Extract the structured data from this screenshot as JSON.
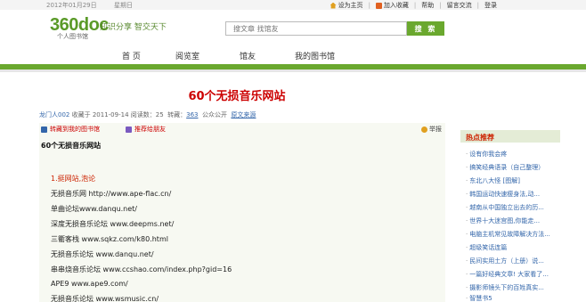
{
  "topbar": {
    "date": "2012年01月29日",
    "weekday": "星期日",
    "links": [
      "设为主页",
      "加入收藏",
      "帮助",
      "留言交流",
      "登录"
    ]
  },
  "header": {
    "logo": "360doc",
    "logo_sub": "个人图书馆",
    "slogan": "知识分享  智交天下",
    "search_placeholder": "搜文章 找馆友",
    "search_button": "搜 索"
  },
  "nav": {
    "items": [
      "首 页",
      "阅览室",
      "馆友",
      "我的图书馆"
    ]
  },
  "article": {
    "title": "60个无损音乐网站",
    "meta": {
      "author": "龙门人002",
      "saved_label": "收藏于",
      "date": "2011-09-14",
      "reads_label": "阅读数：",
      "reads": "25",
      "reposts_label": "转藏：",
      "reposts": "363",
      "visibility": "公众公开",
      "source": "原文来源"
    },
    "actions": {
      "save": "转藏到我的图书馆",
      "recommend": "推荐给朋友",
      "report": "举报"
    },
    "body_title": "60个无损音乐网站",
    "lines": [
      "1.挺网站,泡论",
      "无损音乐网 http://www.ape-flac.cn/",
      "单曲论坛www.danqu.net/",
      "深度无损音乐论坛  www.deepms.net/",
      "三衢客栈 www.sqkz.com/k80.html",
      "无损音乐论坛 www.danqu.net/",
      "串串烧音乐论坛 www.ccshao.com/index.php?gid=16",
      "APE9   www.ape9.com/",
      "无损音乐论坛 www.wsmusic.cn/"
    ]
  },
  "sidebar": {
    "title": "热点推荐",
    "items": [
      "设有你我会疼",
      "搞笑经典语录（自己整理）",
      "东北八大怪 [图解]",
      "韩国运动快速瘦身法,动...",
      "越南从中国独立出去的历...",
      "世界十大迷宫图,你能走...",
      "电脑主机常见故障解决方法...",
      "超级笑话连篇",
      "民间实用土方（上册）说...",
      "一篇好经典文章! 大家看了...",
      "摄影师镜头下的百姓真实...",
      "智慧书5"
    ]
  },
  "colors": {
    "brand_green": "#6aa82e",
    "title_red": "#cc0000",
    "link_blue": "#3366aa"
  }
}
